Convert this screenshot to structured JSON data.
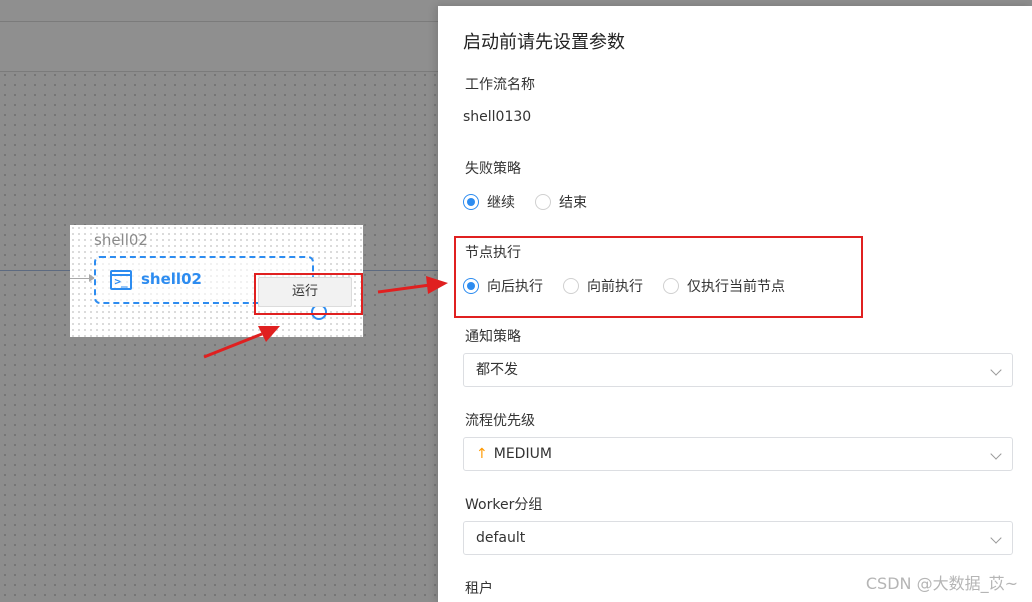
{
  "canvas": {
    "node_caption": "shell02",
    "node_title": "shell02",
    "node_icon_glyph": ">_",
    "run_label": "运行"
  },
  "drawer": {
    "title": "启动前请先设置参数",
    "workflow_name_label": "工作流名称",
    "workflow_name_value": "shell0130",
    "failure_strategy_label": "失败策略",
    "failure_options": [
      "继续",
      "结束"
    ],
    "failure_selected": "继续",
    "node_exec_label": "节点执行",
    "node_exec_options": [
      "向后执行",
      "向前执行",
      "仅执行当前节点"
    ],
    "node_exec_selected": "向后执行",
    "notify_label": "通知策略",
    "notify_value": "都不发",
    "priority_label": "流程优先级",
    "priority_icon": "↑",
    "priority_value": "MEDIUM",
    "worker_group_label": "Worker分组",
    "worker_group_value": "default",
    "tenant_label": "租户"
  },
  "watermark": "CSDN @大数据_苡~",
  "colors": {
    "accent": "#2d8cf0",
    "highlight": "#e02020",
    "priority": "#ff9900"
  }
}
